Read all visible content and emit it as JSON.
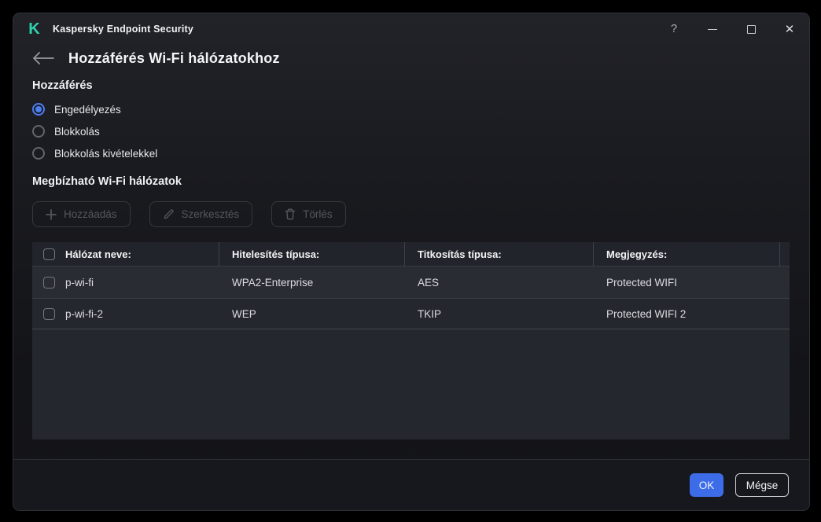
{
  "window": {
    "title": "Kaspersky Endpoint Security",
    "logo_letter": "K",
    "controls": {
      "help": "?",
      "close": "✕"
    }
  },
  "header": {
    "title": "Hozzáférés Wi-Fi hálózatokhoz"
  },
  "access": {
    "heading": "Hozzáférés",
    "options": [
      {
        "label": "Engedélyezés",
        "selected": true
      },
      {
        "label": "Blokkolás",
        "selected": false
      },
      {
        "label": "Blokkolás kivételekkel",
        "selected": false
      }
    ]
  },
  "trusted": {
    "heading": "Megbízható Wi-Fi hálózatok",
    "toolbar": {
      "add": {
        "label": "Hozzáadás",
        "disabled": true
      },
      "edit": {
        "label": "Szerkesztés",
        "disabled": true
      },
      "delete": {
        "label": "Törlés",
        "disabled": true
      }
    }
  },
  "table": {
    "columns": {
      "name": "Hálózat neve:",
      "auth": "Hitelesítés típusa:",
      "encryption": "Titkosítás típusa:",
      "comment": "Megjegyzés:"
    },
    "rows": [
      {
        "name": "p-wi-fi",
        "auth": "WPA2-Enterprise",
        "encryption": "AES",
        "comment": "Protected WIFI",
        "checked": false
      },
      {
        "name": "p-wi-fi-2",
        "auth": "WEP",
        "encryption": "TKIP",
        "comment": "Protected WIFI 2",
        "checked": false
      }
    ]
  },
  "footer": {
    "ok": "OK",
    "cancel": "Mégse"
  },
  "colors": {
    "accent_teal": "#2bd4ae",
    "primary_blue": "#3d6ce8",
    "radio_blue": "#4d7df2",
    "window_bg_top": "#222329",
    "window_bg_bottom": "#131418",
    "table_header_bg": "#22242b",
    "row_odd_bg": "#2a2c34",
    "row_even_bg": "#25272e",
    "disabled_text": "#55565d"
  }
}
